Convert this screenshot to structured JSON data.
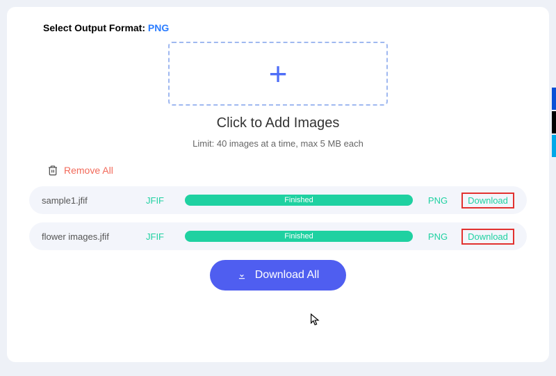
{
  "header": {
    "label": "Select Output Format: ",
    "format": "PNG"
  },
  "dropzone": {
    "title": "Click to Add Images",
    "subtitle": "Limit: 40 images at a time, max 5 MB each"
  },
  "remove_all": "Remove All",
  "files": [
    {
      "name": "sample1.jfif",
      "src_format": "JFIF",
      "status": "Finished",
      "dst_format": "PNG",
      "download": "Download"
    },
    {
      "name": "flower images.jfif",
      "src_format": "JFIF",
      "status": "Finished",
      "dst_format": "PNG",
      "download": "Download"
    }
  ],
  "download_all": "Download All"
}
